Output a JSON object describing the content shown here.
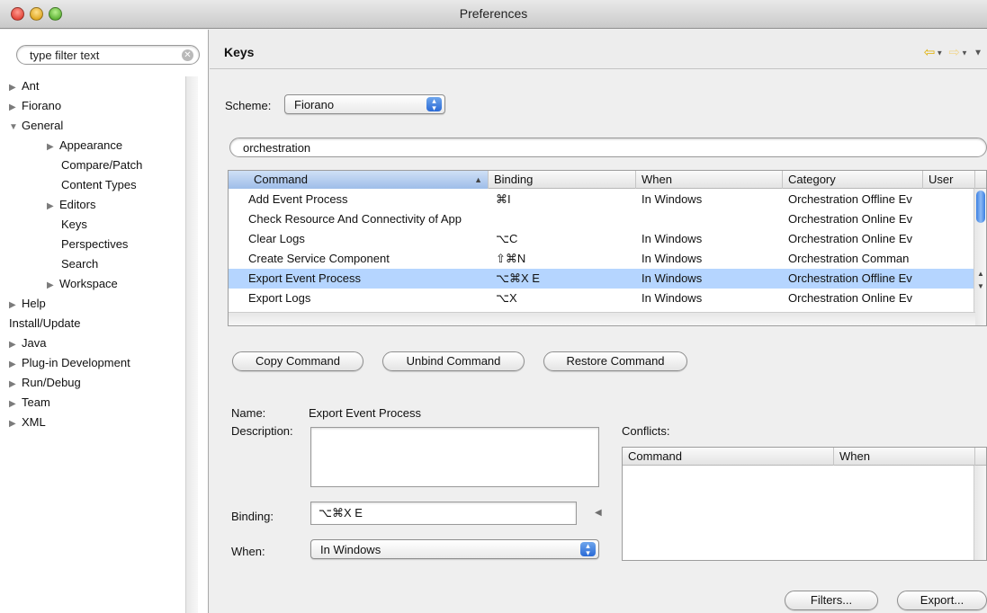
{
  "window": {
    "title": "Preferences"
  },
  "sidebar": {
    "filter_placeholder": "type filter text",
    "items": [
      {
        "label": "Ant",
        "arrow": "▶"
      },
      {
        "label": "Fiorano",
        "arrow": "▶"
      },
      {
        "label": "General",
        "arrow": "▼"
      },
      {
        "label": "Appearance",
        "arrow": "▶"
      },
      {
        "label": "Compare/Patch",
        "arrow": ""
      },
      {
        "label": "Content Types",
        "arrow": ""
      },
      {
        "label": "Editors",
        "arrow": "▶"
      },
      {
        "label": "Keys",
        "arrow": ""
      },
      {
        "label": "Perspectives",
        "arrow": ""
      },
      {
        "label": "Search",
        "arrow": ""
      },
      {
        "label": "Workspace",
        "arrow": "▶"
      },
      {
        "label": "Help",
        "arrow": "▶"
      },
      {
        "label": "Install/Update",
        "arrow": ""
      },
      {
        "label": "Java",
        "arrow": "▶"
      },
      {
        "label": "Plug-in Development",
        "arrow": "▶"
      },
      {
        "label": "Run/Debug",
        "arrow": "▶"
      },
      {
        "label": "Team",
        "arrow": "▶"
      },
      {
        "label": "XML",
        "arrow": "▶"
      }
    ]
  },
  "header": {
    "title": "Keys"
  },
  "scheme": {
    "label": "Scheme:",
    "value": "Fiorano"
  },
  "search": {
    "value": "orchestration"
  },
  "table": {
    "columns": [
      "Command",
      "Binding",
      "When",
      "Category",
      "User"
    ],
    "rows": [
      {
        "command": "Add Event Process",
        "binding": "⌘I",
        "when": "In Windows",
        "category": "Orchestration Offline Ev"
      },
      {
        "command": "Check Resource And Connectivity of App",
        "binding": "",
        "when": "",
        "category": "Orchestration Online Ev"
      },
      {
        "command": "Clear Logs",
        "binding": "⌥C",
        "when": "In Windows",
        "category": "Orchestration Online Ev"
      },
      {
        "command": "Create Service Component",
        "binding": "⇧⌘N",
        "when": "In Windows",
        "category": "Orchestration Comman"
      },
      {
        "command": "Export Event Process",
        "binding": "⌥⌘X E",
        "when": "In Windows",
        "category": "Orchestration Offline Ev"
      },
      {
        "command": "Export Logs",
        "binding": "⌥X",
        "when": "In Windows",
        "category": "Orchestration Online Ev"
      }
    ]
  },
  "buttons": {
    "copy": "Copy Command",
    "unbind": "Unbind Command",
    "restore": "Restore Command",
    "filters": "Filters...",
    "export": "Export..."
  },
  "details": {
    "name_label": "Name:",
    "name_value": "Export Event Process",
    "description_label": "Description:",
    "binding_label": "Binding:",
    "binding_value": "⌥⌘X E",
    "when_label": "When:",
    "when_value": "In Windows"
  },
  "conflicts": {
    "label": "Conflicts:",
    "columns": [
      "Command",
      "When"
    ]
  }
}
